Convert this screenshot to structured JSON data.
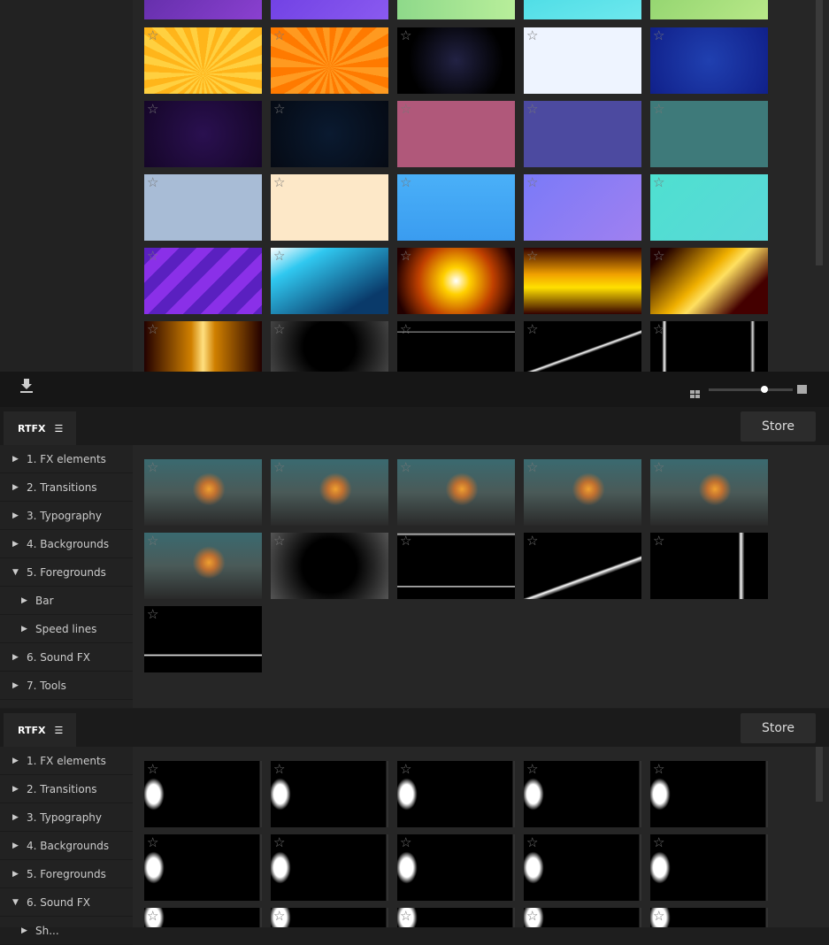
{
  "toolbar": {
    "download_icon": "download-icon",
    "grid_icon": "grid-small-icon",
    "large_icon": "grid-large-icon",
    "thumbnail_size": 0.66
  },
  "panels": [
    {
      "tab_label": "RTFX",
      "store_label": "Store",
      "nav": [
        {
          "label": "1. FX elements",
          "expanded": false
        },
        {
          "label": "2. Transitions",
          "expanded": false
        },
        {
          "label": "3. Typography",
          "expanded": false
        },
        {
          "label": "4. Backgrounds",
          "expanded": false
        },
        {
          "label": "5. Foregrounds",
          "expanded": true
        },
        {
          "label": "Bar",
          "sub": true
        },
        {
          "label": "Speed lines",
          "sub": true
        },
        {
          "label": "6. Sound FX",
          "expanded": false
        },
        {
          "label": "7. Tools",
          "expanded": false
        }
      ]
    },
    {
      "tab_label": "RTFX",
      "store_label": "Store",
      "nav": [
        {
          "label": "1. FX elements",
          "expanded": false
        },
        {
          "label": "2. Transitions",
          "expanded": false
        },
        {
          "label": "3. Typography",
          "expanded": false
        },
        {
          "label": "4. Backgrounds",
          "expanded": false
        },
        {
          "label": "5. Foregrounds",
          "expanded": false
        },
        {
          "label": "6. Sound FX",
          "expanded": true
        },
        {
          "label": "Sh...",
          "sub": true
        }
      ]
    }
  ],
  "star_glyph": "☆"
}
